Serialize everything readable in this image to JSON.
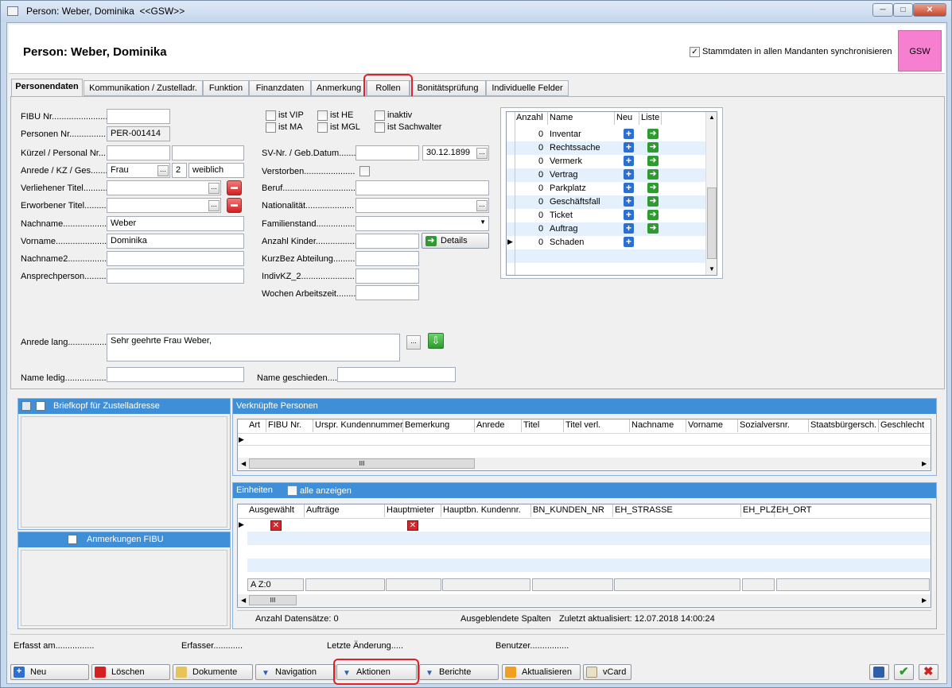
{
  "window": {
    "title": "Person: Weber, Dominika  <<GSW>>",
    "controls": [
      "minimize",
      "maximize",
      "close"
    ]
  },
  "header": {
    "title": "Person: Weber, Dominika",
    "sync_checkbox_label": "Stammdaten in allen Mandanten synchronisieren",
    "sync_checked": true,
    "mandant_badge": "GSW",
    "badge_color": "#f77fcf"
  },
  "tabs": [
    {
      "label": "Personendaten",
      "active": true
    },
    {
      "label": "Kommunikation / Zustelladr."
    },
    {
      "label": "Funktion"
    },
    {
      "label": "Finanzdaten"
    },
    {
      "label": "Anmerkung"
    },
    {
      "label": "Rollen",
      "highlighted": true
    },
    {
      "label": "Bonitätsprüfung"
    },
    {
      "label": "Individuelle Felder"
    }
  ],
  "form": {
    "fibu_label": "FIBU Nr........................",
    "fibu_value": "",
    "personen_label": "Personen Nr.................",
    "personen_value": "PER-001414",
    "kuerzel_label": "Kürzel / Personal Nr.......",
    "anrede_label": "Anrede / KZ / Ges.........",
    "anrede_value": "Frau",
    "kz_value": "2",
    "ges_value": "weiblich",
    "verl_titel_label": "Verliehener Titel.............",
    "erw_titel_label": "Erworbener Titel..............",
    "nachname_label": "Nachname.....................",
    "nachname_value": "Weber",
    "vorname_label": "Vorname.......................",
    "vorname_value": "Dominika",
    "nachname2_label": "Nachname2....................",
    "ansprech_label": "Ansprechperson.............",
    "vip_label": "ist VIP",
    "he_label": "ist HE",
    "inaktiv_label": "inaktiv",
    "ma_label": "ist MA",
    "mgl_label": "ist MGL",
    "sachwalter_label": "ist Sachwalter",
    "sv_label": "SV-Nr. / Geb.Datum.........",
    "geb_value": "30.12.1899",
    "verstorben_label": "Verstorben.....................",
    "beruf_label": "Beruf..............................",
    "nationalitaet_label": "Nationalität....................",
    "familienstand_label": "Familienstand..................",
    "kinder_label": "Anzahl Kinder..................",
    "details_label": "Details",
    "kurzbez_label": "KurzBez Abteilung.........",
    "indivkz_label": "IndivKZ_2......................",
    "wochen_label": "Wochen Arbeitszeit........",
    "anrede_lang_label": "Anrede lang.................",
    "anrede_lang_value": "Sehr geehrte Frau Weber,",
    "name_ledig_label": "Name ledig....................",
    "name_gesch_label": "Name geschieden...."
  },
  "roles_grid": {
    "headers": [
      "Anzahl",
      "Name",
      "Neu",
      "Liste"
    ],
    "rows": [
      {
        "count": "0",
        "name": "Inventar"
      },
      {
        "count": "0",
        "name": "Rechtssache"
      },
      {
        "count": "0",
        "name": "Vermerk"
      },
      {
        "count": "0",
        "name": "Vertrag"
      },
      {
        "count": "0",
        "name": "Parkplatz"
      },
      {
        "count": "0",
        "name": "Geschäftsfall"
      },
      {
        "count": "0",
        "name": "Ticket"
      },
      {
        "count": "0",
        "name": "Auftrag"
      },
      {
        "count": "0",
        "name": "Schaden"
      }
    ]
  },
  "briefkopf": {
    "title": "Briefkopf für Zustelladresse"
  },
  "anmerkungen": {
    "title": "Anmerkungen FIBU"
  },
  "verknuepfte": {
    "title": "Verknüpfte Personen",
    "columns": [
      "Art",
      "FIBU Nr.",
      "Urspr. Kundennummer",
      "Bemerkung",
      "Anrede",
      "Titel",
      "Titel verl.",
      "Nachname",
      "Vorname",
      "Sozialversnr.",
      "Staatsbürgersch.",
      "Geschlecht"
    ]
  },
  "einheiten": {
    "title": "Einheiten",
    "alle_label": "alle anzeigen",
    "columns": [
      "Ausgewählt",
      "Aufträge",
      "Hauptmieter",
      "Hauptbn. Kundennr.",
      "BN_KUNDEN_NR",
      "EH_STRASSE",
      "EH_PLZ",
      "EH_ORT"
    ],
    "footer_cell": "A Z:0",
    "status_count": "Anzahl Datensätze: 0",
    "status_hidden": "Ausgeblendete Spalten",
    "status_updated": "Zuletzt aktualisiert: 12.07.2018 14:00:24"
  },
  "audit": {
    "erfasst": "Erfasst am................",
    "erfasser": "Erfasser............",
    "letzte": "Letzte Änderung.....",
    "benutzer": "Benutzer................"
  },
  "toolbar": {
    "neu": "Neu",
    "loeschen": "Löschen",
    "dokumente": "Dokumente",
    "navigation": "Navigation",
    "aktionen": "Aktionen",
    "berichte": "Berichte",
    "aktualisieren": "Aktualisieren",
    "vcard": "vCard"
  }
}
